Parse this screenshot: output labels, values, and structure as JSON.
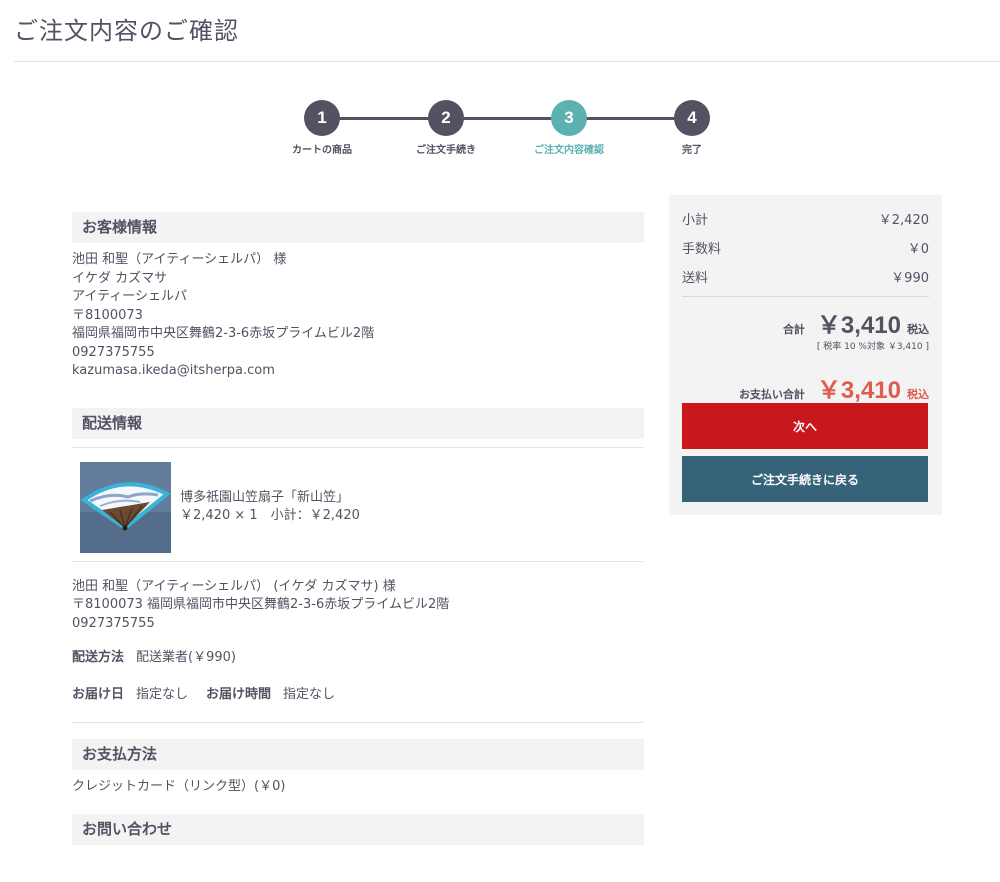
{
  "page": {
    "title": "ご注文内容のご確認"
  },
  "steps": [
    {
      "num": "1",
      "label": "カートの商品"
    },
    {
      "num": "2",
      "label": "ご注文手続き"
    },
    {
      "num": "3",
      "label": "ご注文内容確認"
    },
    {
      "num": "4",
      "label": "完了"
    }
  ],
  "customer": {
    "heading": "お客様情報",
    "name": "池田 和聖（アイティーシェルパ） 様",
    "kana": "イケダ カズマサ",
    "company": "アイティーシェルパ",
    "postal": "〒8100073",
    "address": "福岡県福岡市中央区舞鶴2-3-6赤坂プライムビル2階",
    "phone": "0927375755",
    "email": "kazumasa.ikeda@itsherpa.com"
  },
  "shipping": {
    "heading": "配送情報",
    "product_name": "博多祇園山笠扇子「新山笠」",
    "product_price_line": "￥2,420 × 1　小計：￥2,420",
    "recipient": "池田 和聖（アイティーシェルパ） (イケダ カズマサ) 様",
    "address_line": "〒8100073 福岡県福岡市中央区舞鶴2-3-6赤坂プライムビル2階",
    "phone": "0927375755",
    "method_label": "配送方法",
    "method_value": "配送業者(￥990)",
    "date_label": "お届け日",
    "date_value": "指定なし",
    "time_label": "お届け時間",
    "time_value": "指定なし"
  },
  "payment": {
    "heading": "お支払方法",
    "value": "クレジットカード（リンク型）(￥0)"
  },
  "contact": {
    "heading": "お問い合わせ"
  },
  "summary": {
    "subtotal_label": "小計",
    "subtotal_value": "￥2,420",
    "fee_label": "手数料",
    "fee_value": "￥0",
    "shipping_label": "送料",
    "shipping_value": "￥990",
    "total_label": "合計",
    "total_value": "￥3,410",
    "tax_incl": "税込",
    "tax_note": "[ 税率 10 %対象 ￥3,410 ]",
    "pay_total_label": "お支払い合計",
    "pay_total_value": "￥3,410",
    "next_button": "次へ",
    "back_button": "ご注文手続きに戻る"
  },
  "colors": {
    "primary": "#525263",
    "accent": "#5cb1b1",
    "danger": "#c9171e",
    "price": "#de5d50",
    "secondary": "#366379"
  }
}
